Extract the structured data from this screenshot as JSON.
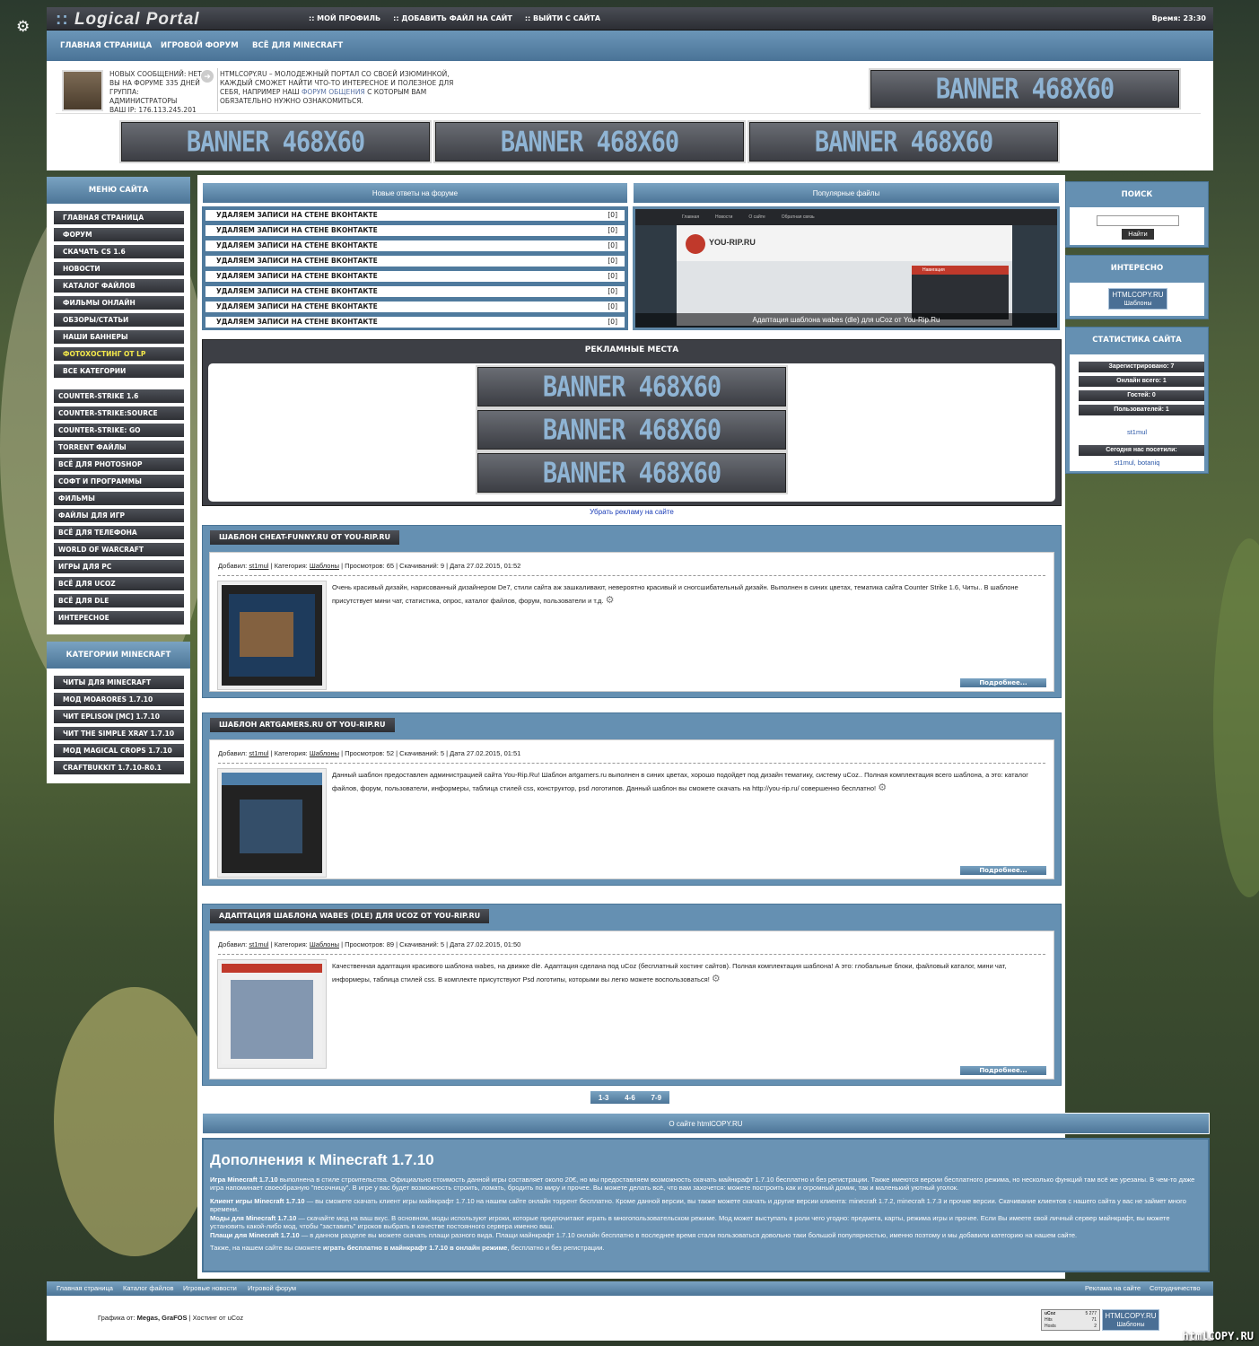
{
  "topbar": {
    "logo_prefix": "::",
    "logo": "Logical Portal",
    "links": [
      ":: Мой профиль",
      ":: Добавить файл на сайт",
      ":: Выйти с сайта"
    ],
    "time": "Время: 23:30"
  },
  "nav": [
    "Главная страница",
    "Игровой форум",
    "Всё для Minecraft"
  ],
  "user": {
    "line1": "Новых сообщений: нет",
    "line2": "Вы на форуме 335 дней",
    "line3": "Группа: Администраторы",
    "line4": "Ваш IP: 176.113.245.201"
  },
  "intro": {
    "text1": "HTMLCOPY.RU – молодежный портал со своей изюминкой, каждый сможет найти что-то интересное и полезное для себя, например наш ",
    "link": "форум общения",
    "text2": " с которым вам обязательно нужно ознакомиться."
  },
  "banner": "BANNER 468X60",
  "left_menu": {
    "title": "Меню сайта",
    "items": [
      "Главная страница",
      "Форум",
      "Скачать CS 1.6",
      "Новости",
      "Каталог файлов",
      "Фильмы онлайн",
      "Обзоры/Статьи",
      "Наши баннеры",
      "Фотохостинг от LP",
      "Все категории"
    ],
    "items2": [
      "Counter-Strike 1.6",
      "Counter-Strike:Source",
      "Counter-Strike: GO",
      "Torrent файлы",
      "Всё для PhotoShop",
      "Софт и программы",
      "Фильмы",
      "Файлы для игр",
      "Всё для телефона",
      "World of Warcraft",
      "Игры для PC",
      "Всё для uCoz",
      "Всё для DLE",
      "Интересное"
    ]
  },
  "left_mc": {
    "title": "Категории Minecraft",
    "items": [
      "Читы для Minecraft",
      "Мод MoarOres 1.7.10",
      "Чит Eplison [MC] 1.7.10",
      "Чит The Simple Xray 1.7.10",
      "Мод Magical Crops 1.7.10",
      "CraftBukkit 1.7.10-R0.1"
    ]
  },
  "forum": {
    "title": "Новые ответы на форуме",
    "rows": [
      "Удаляем записи на стене ВКонтакте",
      "Удаляем записи на стене ВКонтакте",
      "Удаляем записи на стене ВКонтакте",
      "Удаляем записи на стене ВКонтакте",
      "Удаляем записи на стене ВКонтакте",
      "Удаляем записи на стене ВКонтакте",
      "Удаляем записи на стене ВКонтакте",
      "Удаляем записи на стене ВКонтакте"
    ],
    "count": "[0]"
  },
  "popular": {
    "title": "Популярные файлы",
    "caption": "Адаптация шаблона wabes (dle) для uCoz от You-Rip.Ru",
    "logo": "YOU-RIP.RU",
    "menu": [
      "Главная",
      "Новости",
      "О сайте",
      "Обратная связь"
    ],
    "side_title": "Навигация"
  },
  "ads": {
    "title": "Рекламные места",
    "remove": "Убрать рекламу на сайте"
  },
  "posts": [
    {
      "title": "Шаблон Cheat-Funny.ru от You-Rip.Ru",
      "added_label": "Добавил:",
      "author": "st1mul",
      "cat_label": "Категория:",
      "category": "Шаблоны",
      "stats": "Просмотров: 65 | Скачиваний: 9 | Дата 27.02.2015, 01:52",
      "text": "Очень красивый дизайн, нарисованный дизайнером De7, стили сайта аж зашкаливают, невероятно красивый и сногсшибательный дизайн. Выполнен в синих цветах, тематика сайта Counter Strike 1.6, Читы.. В шаблоне присутствует мини чат, статистика, опрос, каталог файлов, форум, пользователи и т.д.",
      "more": "Подробнее..."
    },
    {
      "title": "Шаблон ArtGamers.ru от You-Rip.Ru",
      "added_label": "Добавил:",
      "author": "st1mul",
      "cat_label": "Категория:",
      "category": "Шаблоны",
      "stats": "Просмотров: 52 | Скачиваний: 5 | Дата 27.02.2015, 01:51",
      "text": "Данный шаблон предоставлен администрацией сайта You-Rip.Ru! Шаблон artgamers.ru выполнен в синих цветах, хорошо подойдет под дизайн тематику, систему uCoz.. Полная комплектация всего шаблона, а это: каталог файлов, форум, пользователи, информеры, таблица стилей css, конструктор, psd логотипов. Данный шаблон вы сможете скачать на http://you-rip.ru/ совершенно бесплатно!",
      "more": "Подробнее..."
    },
    {
      "title": "Адаптация шаблона wabes (dle) для uCoz от You-Rip.Ru",
      "added_label": "Добавил:",
      "author": "st1mul",
      "cat_label": "Категория:",
      "category": "Шаблоны",
      "stats": "Просмотров: 89 | Скачиваний: 5 | Дата 27.02.2015, 01:50",
      "text": "Качественная адаптация красивого шаблона wabes, на движке dle. Адаптация сделана под uCoz (бесплатный хостинг сайтов). Полная комплектация шаблона! А это: глобальные блоки, файловый каталог, мини чат, информеры, таблица стилей css. В комплекте присутствуют Psd логотипы, которыми вы легко можете воспользоваться!",
      "more": "Подробнее..."
    }
  ],
  "pages": [
    "1-3",
    "4-6",
    "7-9"
  ],
  "about": {
    "title": "О сайте htmlCOPY.RU",
    "heading": "Дополнения к Minecraft 1.7.10",
    "p1b": "Игра Minecraft 1.7.10",
    "p1": " выполнена в стиле строительства. Официально стоимость данной игры составляет около 20€, но мы предоставляем возможность скачать майнкрафт 1.7.10 бесплатно и без регистрации. Также имеются версии бесплатного режима, но несколько функций там всё же урезаны. В чем-то даже игра напоминает своеобразную \"песочницу\". В игре у вас будет возможность строить, ломать, бродить по миру и прочее. Вы можете делать всё, что вам захочется: можете построить как и огромный домик, так и маленький уютный уголок.",
    "p2b": "Клиент игры Minecraft 1.7.10",
    "p2": " — вы сможете скачать клиент игры майнкрафт 1.7.10 на нашем сайте онлайн торрент бесплатно. Кроме данной версии, вы также можете скачать и другие версии клиента: minecraft 1.7.2, minecraft 1.7.3 и прочие версии. Скачивание клиентов с нашего сайта у вас не займет много времени.",
    "p3b": "Моды для Minecraft 1.7.10",
    "p3": " — скачайте мод на ваш вкус. В основном, моды используют игроки, которые предпочитают играть в многопользовательском режиме. Мод может выступать в роли чего угодно: предмета, карты, режима игры и прочее. Если Вы имеете свой личный сервер майнкрафт, вы можете установить какой-либо мод, чтобы \"заставить\" игроков выбрать в качестве постоянного сервера именно ваш.",
    "p4b": "Плащи для Minecraft 1.7.10",
    "p4": " — в данном разделе вы можете скачать плащи разного вида. Плащи майнкрафт 1.7.10 онлайн бесплатно в последнее время стали пользоваться довольно таки большой популярностью, именно поэтому и мы добавили категорию на нашем сайте.",
    "p5": "Также, на нашем сайте вы сможете ",
    "p5b": "играть бесплатно в майнкрафт 1.7.10 в онлайн режиме",
    "p5c": ", бесплатно и без регистрации."
  },
  "search": {
    "title": "Поиск",
    "button": "Найти"
  },
  "interesting": {
    "title": "Интересно",
    "badge1": "HTMLCOPY.RU",
    "badge2": "Шаблоны"
  },
  "stats": {
    "title": "Статистика сайта",
    "rows": [
      "Зарегистрировано: 7",
      "Онлайн всего: 1",
      "Гостей: 0",
      "Пользователей: 1"
    ],
    "online_user": "st1mul",
    "today": "Сегодня нас посетили:",
    "today_users": "st1mul, botaniq"
  },
  "footer": {
    "links": [
      "Главная страница",
      "Каталог файлов",
      "Игровые новости",
      "Игровой форум"
    ],
    "right_links": [
      "Реклама на сайте",
      "Сотрудничество"
    ],
    "credits_label": "Графика от: ",
    "credits_names": "Megas, GraFOS",
    "credits_host": " | Хостинг от uCoz",
    "counter": "uCoz",
    "counter_val": "5 277",
    "counter_hits": "Hits",
    "counter_hits_val": "71",
    "counter_hosts": "Hosts",
    "counter_hosts_val": "2",
    "watermark": "htmlCOPY.RU"
  }
}
